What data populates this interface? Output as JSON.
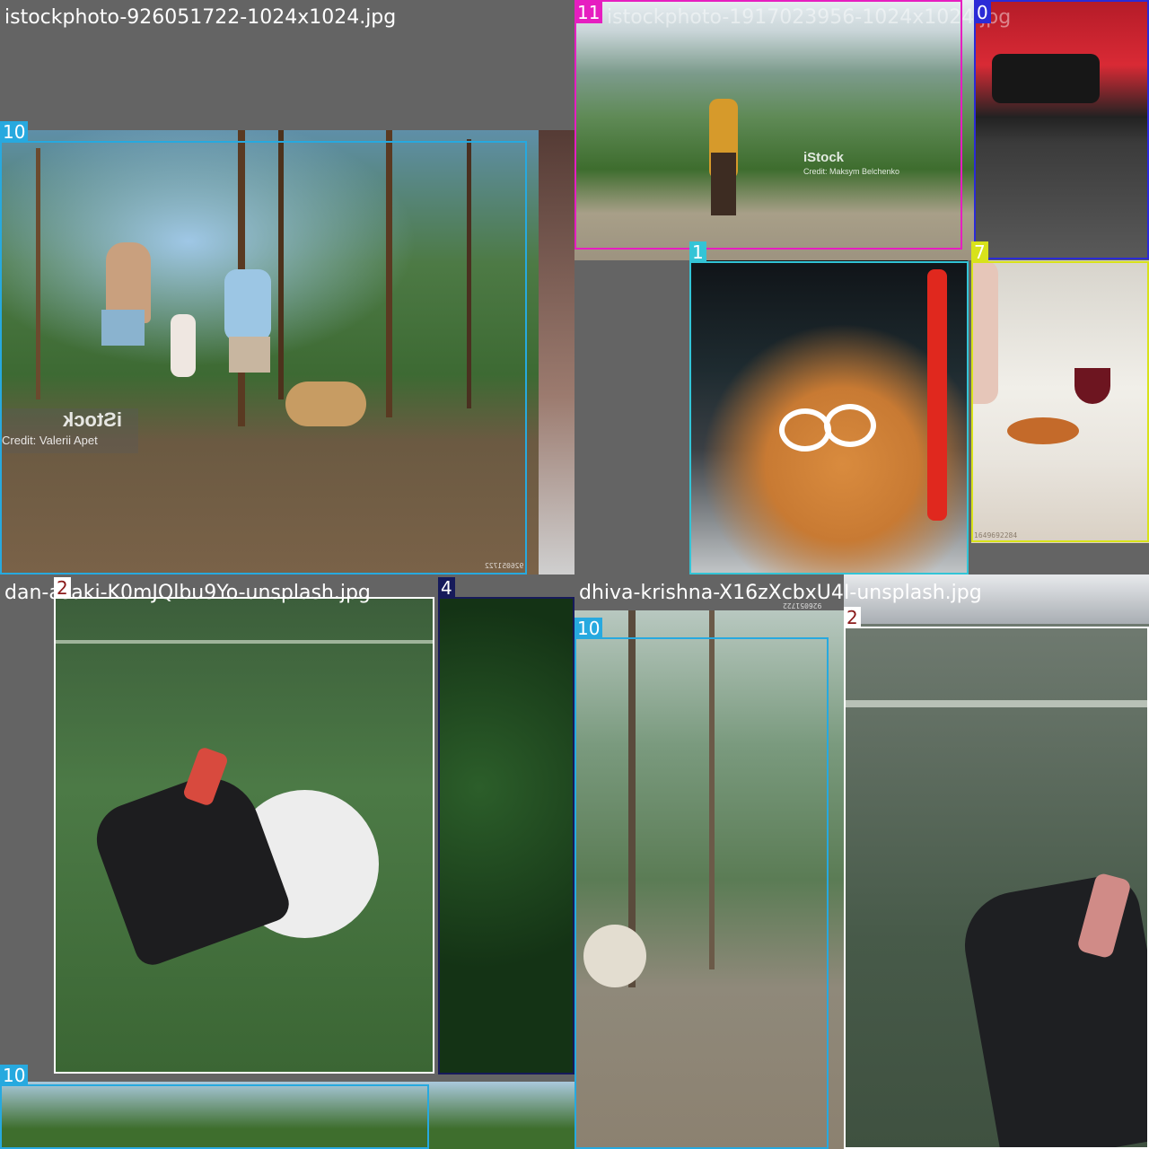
{
  "mosaic": [
    {
      "filename": "istockphoto-926051722-1024x1024.jpg",
      "watermark": {
        "brand": "iStock",
        "credit": "Credit: Valerii Apet"
      },
      "stock_id": "926051722"
    },
    {
      "filename": "istockphoto-1917023956-1024x1024.jpg",
      "watermark": {
        "brand": "iStock",
        "credit": "Credit: Maksym  Belchenko"
      },
      "stock_id": "1917023956"
    },
    {
      "filename": "dan-asaki-K0mJQlbu9Yo-unsplash.jpg"
    },
    {
      "filename": "dhiva-krishna-X16zXcbxU4I-unsplash.jpg",
      "stock_id": "926051722"
    }
  ],
  "detections": [
    {
      "label": "11",
      "color": "#e61ec0"
    },
    {
      "label": "0",
      "color": "#2b2bd6"
    },
    {
      "label": "10",
      "color": "#27a9df"
    },
    {
      "label": "1",
      "color": "#33c4d6"
    },
    {
      "label": "7",
      "color": "#d8e21a"
    },
    {
      "label": "2",
      "color": "#ffffff"
    },
    {
      "label": "4",
      "color": "#161a5a"
    },
    {
      "label": "10",
      "color": "#27a9df"
    },
    {
      "label": "10",
      "color": "#27a9df"
    },
    {
      "label": "2",
      "color": "#ffffff"
    }
  ],
  "misc": {
    "stock_tiny_1": "926051722",
    "stock_tiny_2": "1649692284"
  }
}
